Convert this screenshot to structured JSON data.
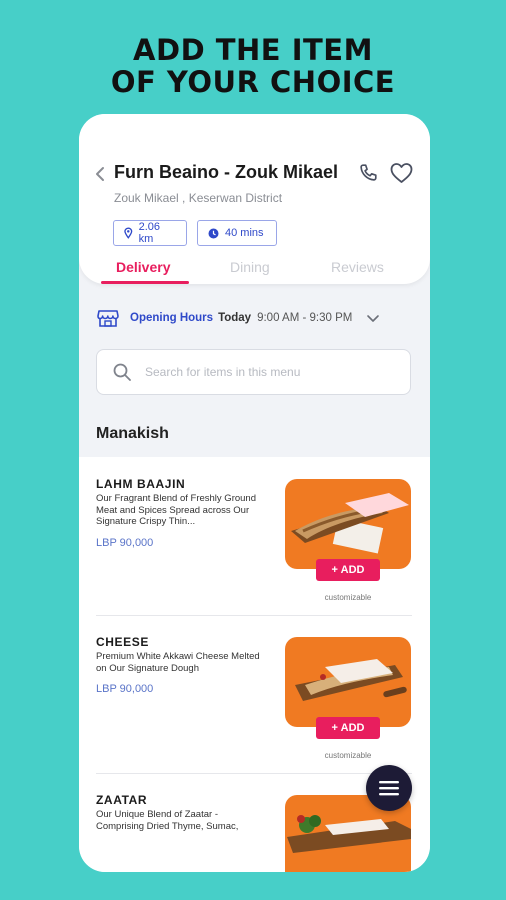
{
  "headline": {
    "line1": "ADD THE ITEM",
    "line2": "OF YOUR CHOICE"
  },
  "restaurant": {
    "name": "Furn Beaino - Zouk Mikael",
    "location": "Zouk Mikael , Keserwan District",
    "distance": "2.06 km",
    "delivery_time": "40 mins"
  },
  "tabs": [
    {
      "label": "Delivery",
      "active": true
    },
    {
      "label": "Dining",
      "active": false
    },
    {
      "label": "Reviews",
      "active": false
    }
  ],
  "hours": {
    "label": "Opening Hours",
    "day": "Today",
    "time": "9:00 AM - 9:30 PM"
  },
  "search": {
    "placeholder": "Search for items in this menu"
  },
  "section": {
    "title": "Manakish"
  },
  "items": [
    {
      "name": "LAHM BAAJIN",
      "description": "Our Fragrant Blend of Freshly Ground Meat and Spices Spread across Our Signature Crispy Thin...",
      "price": "LBP 90,000",
      "add_label": "+ ADD",
      "tag": "customizable"
    },
    {
      "name": "CHEESE",
      "description": "Premium White Akkawi Cheese Melted on Our Signature Dough",
      "price": "LBP 90,000",
      "add_label": "+ ADD",
      "tag": "customizable"
    },
    {
      "name": "ZAATAR",
      "description": "Our Unique Blend of Zaatar - Comprising Dried Thyme, Sumac,",
      "price": "",
      "add_label": "",
      "tag": ""
    }
  ],
  "colors": {
    "background": "#47cfc8",
    "accent": "#e81e5e",
    "link_blue": "#2f49c9",
    "fab": "#1d1b36"
  },
  "icons": [
    "back-chevron-icon",
    "phone-icon",
    "heart-icon",
    "location-pin-icon",
    "clock-icon",
    "store-icon",
    "chevron-down-icon",
    "search-icon",
    "menu-icon"
  ]
}
